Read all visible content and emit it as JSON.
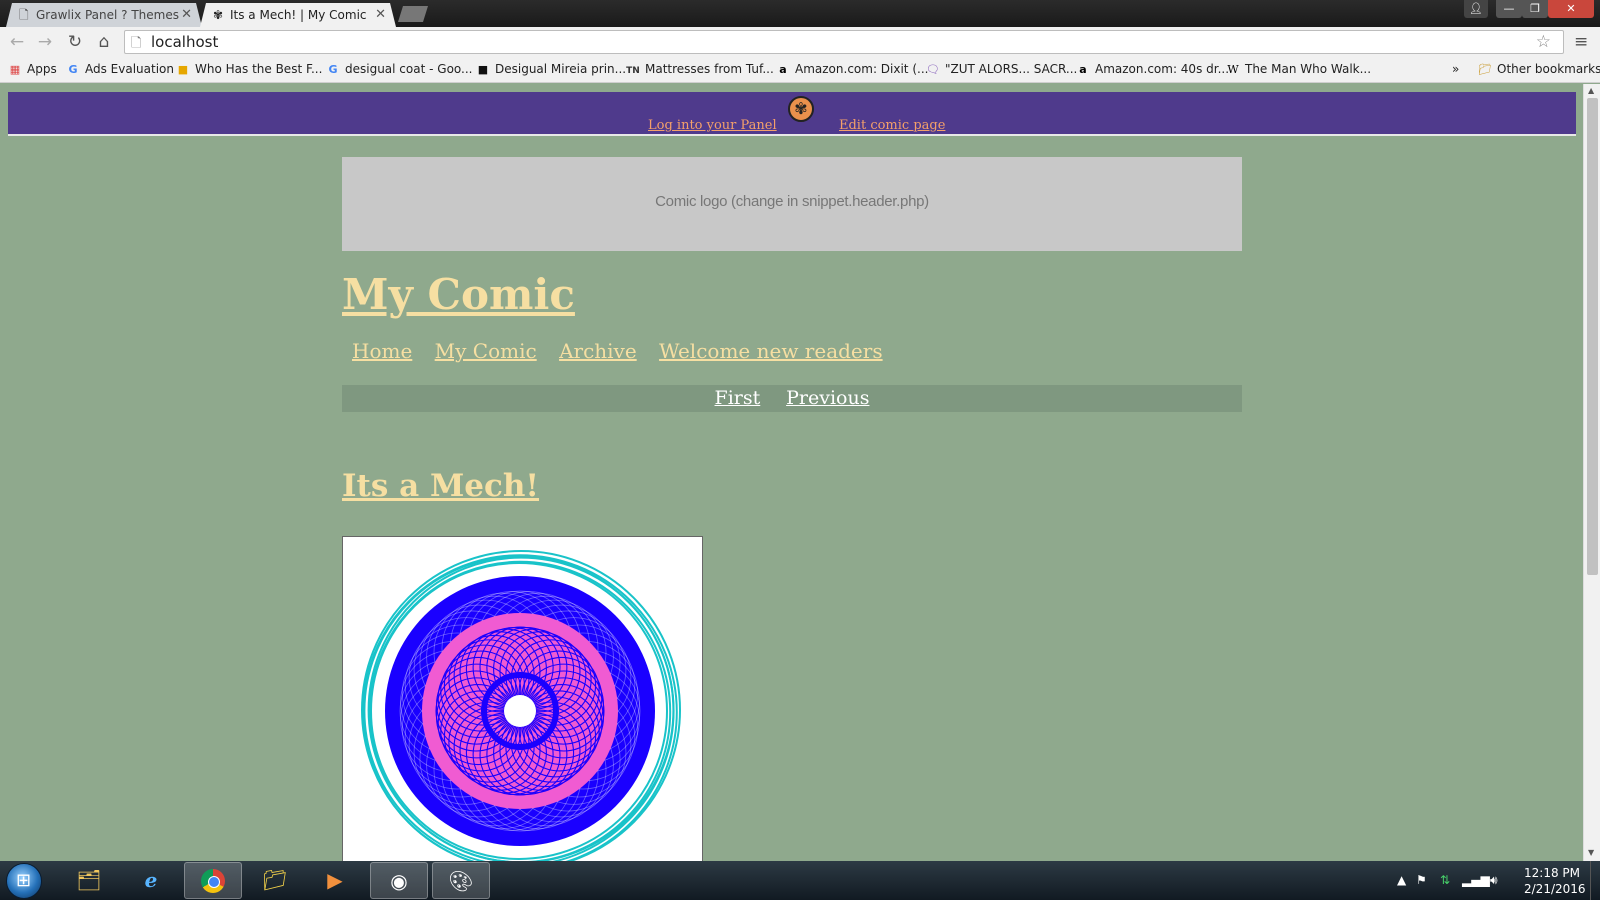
{
  "browser": {
    "tabs": [
      {
        "title": "Grawlix Panel ? Themes",
        "icon": "page-icon",
        "active": false
      },
      {
        "title": "Its a Mech! | My Comic",
        "icon": "grawlix-favicon-icon",
        "active": true
      }
    ],
    "url": "localhost",
    "bookmarks": [
      {
        "label": "Apps",
        "icon": "apps-grid-icon"
      },
      {
        "label": "Ads Evaluation",
        "icon": "google-icon"
      },
      {
        "label": "Who Has the Best F...",
        "icon": "site-icon"
      },
      {
        "label": "desigual coat - Goo...",
        "icon": "google-icon"
      },
      {
        "label": "Desigual Mireia prin...",
        "icon": "site-icon"
      },
      {
        "label": "Mattresses from Tuf...",
        "icon": "tn-icon"
      },
      {
        "label": "Amazon.com: Dixit (...",
        "icon": "amazon-icon"
      },
      {
        "label": "\"ZUT ALORS... SACR...",
        "icon": "chat-icon"
      },
      {
        "label": "Amazon.com: 40s dr...",
        "icon": "amazon-icon"
      },
      {
        "label": "The Man Who Walk...",
        "icon": "wikipedia-icon"
      }
    ],
    "bookmarks_more": "»",
    "other_bookmarks": "Other bookmarks"
  },
  "admin_bar": {
    "login_link": "Log into your Panel",
    "edit_link": "Edit comic page"
  },
  "header": {
    "logo_placeholder": "Comic logo (change in snippet.header.php)",
    "site_title": "My Comic"
  },
  "main_nav": [
    "Home",
    "My Comic",
    "Archive",
    "Welcome new readers"
  ],
  "comic_nav": {
    "first": "First",
    "previous": "Previous"
  },
  "comic": {
    "title": "Its a Mech!",
    "image_colors": {
      "outer_ring": "#19c3c9",
      "middle": "#1a00ff",
      "inner": "#f05bd2",
      "center": "#ffffff"
    }
  },
  "colors": {
    "page_bg": "#8fa98d",
    "admin_bar_bg": "#4f3a8c",
    "admin_link": "#f4a06a",
    "link": "#f6dfa2",
    "comic_nav_bg": "#7f9880"
  },
  "taskbar": {
    "time": "12:18 PM",
    "date": "2/21/2016"
  }
}
